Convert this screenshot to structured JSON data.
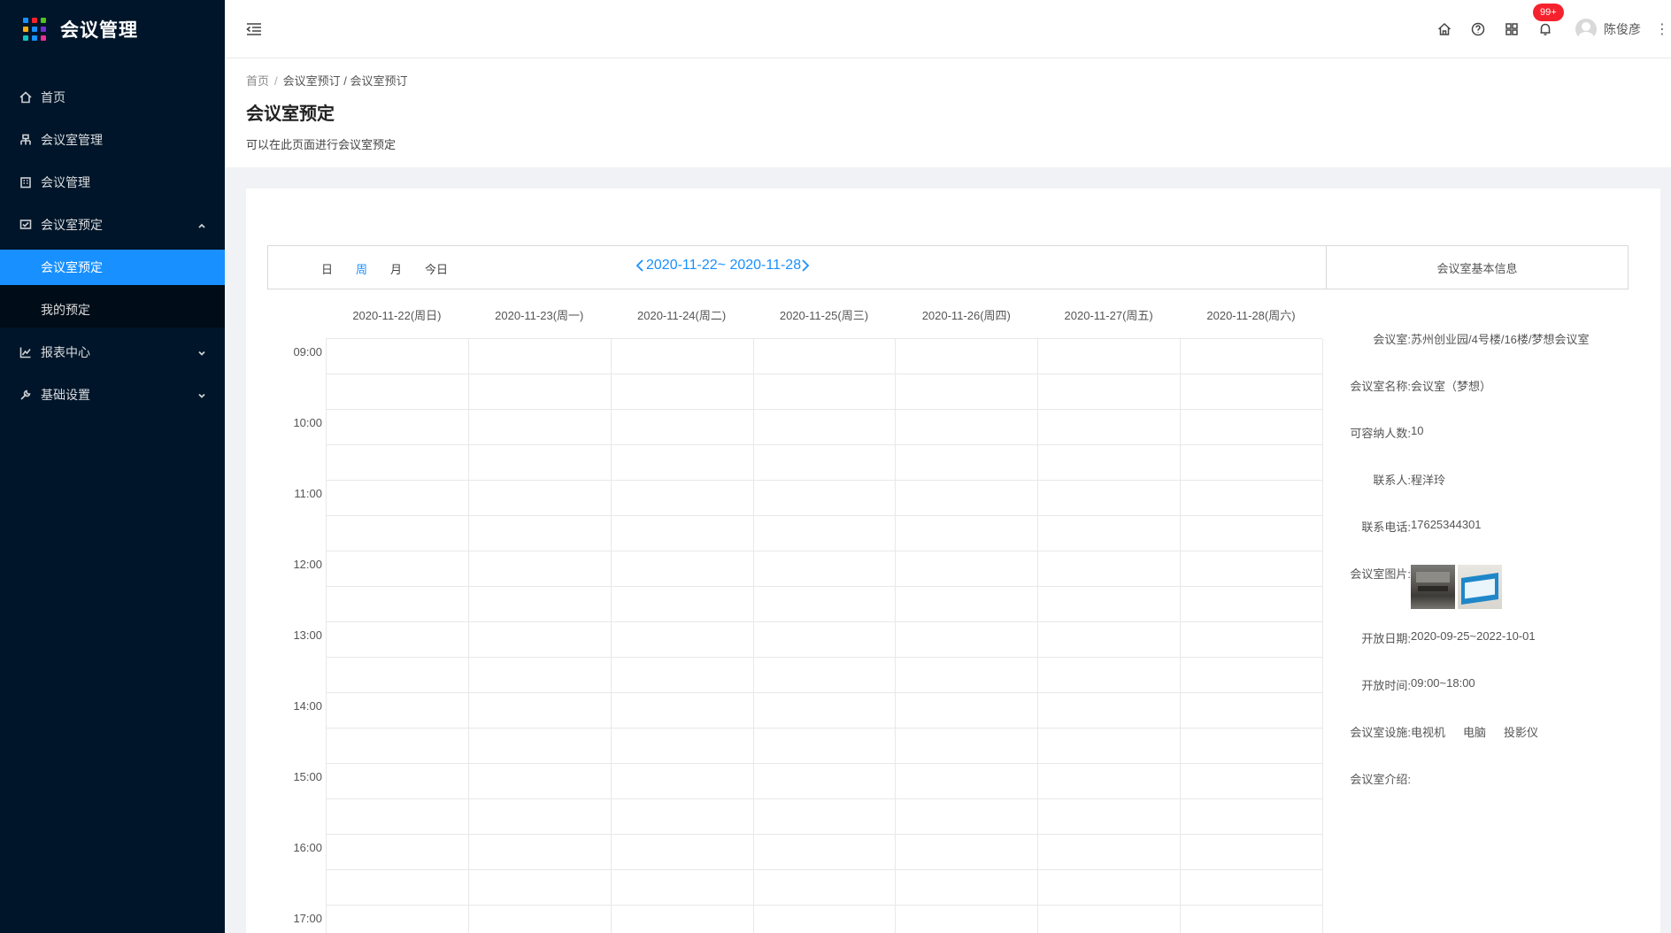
{
  "sidebar": {
    "title": "会议管理",
    "logo_colors": [
      "#1890ff",
      "#f5222d",
      "#52c41a",
      "#faad14",
      "#1890ff",
      "#722ed1",
      "#13c2c2",
      "#1890ff",
      "#eb2f96"
    ],
    "items": [
      {
        "label": "首页",
        "icon": "home-icon"
      },
      {
        "label": "会议室管理",
        "icon": "room-icon"
      },
      {
        "label": "会议管理",
        "icon": "building-icon"
      },
      {
        "label": "会议室预定",
        "icon": "booking-icon",
        "expanded": true,
        "children": [
          {
            "label": "会议室预定",
            "active": true
          },
          {
            "label": "我的预定",
            "active": false
          }
        ]
      },
      {
        "label": "报表中心",
        "icon": "chart-icon",
        "expanded": false
      },
      {
        "label": "基础设置",
        "icon": "wrench-icon",
        "expanded": false
      }
    ]
  },
  "header": {
    "notification_badge": "99+",
    "username": "陈俊彦",
    "more": "⋮"
  },
  "page": {
    "breadcrumb": [
      "首页",
      "会议室预订 / 会议室预订"
    ],
    "title": "会议室预定",
    "description": "可以在此页面进行会议室预定"
  },
  "calendar": {
    "views": [
      {
        "label": "日",
        "active": false
      },
      {
        "label": "周",
        "active": true
      },
      {
        "label": "月",
        "active": false
      },
      {
        "label": "今日",
        "active": false
      }
    ],
    "range_label": "2020-11-22~ 2020-11-28",
    "days": [
      "2020-11-22(周日)",
      "2020-11-23(周一)",
      "2020-11-24(周二)",
      "2020-11-25(周三)",
      "2020-11-26(周四)",
      "2020-11-27(周五)",
      "2020-11-28(周六)"
    ],
    "times": [
      "09:00",
      "10:00",
      "11:00",
      "12:00",
      "13:00",
      "14:00",
      "15:00",
      "16:00",
      "17:00"
    ]
  },
  "room_info": {
    "header": "会议室基本信息",
    "room_label": "会议室:",
    "room_value": "苏州创业园/4号楼/16楼/梦想会议室",
    "name_label": "会议室名称:",
    "name_value": "会议室（梦想）",
    "capacity_label": "可容纳人数:",
    "capacity_value": "10",
    "contact_label": "联系人:",
    "contact_value": "程洋玲",
    "phone_label": "联系电话:",
    "phone_value": "17625344301",
    "images_label": "会议室图片:",
    "open_date_label": "开放日期:",
    "open_date_value": "2020-09-25~2022-10-01",
    "open_time_label": "开放时间:",
    "open_time_value": "09:00~18:00",
    "facilities_label": "会议室设施:",
    "facilities": [
      "电视机",
      "电脑",
      "投影仪"
    ],
    "intro_label": "会议室介绍:",
    "intro_value": ""
  }
}
